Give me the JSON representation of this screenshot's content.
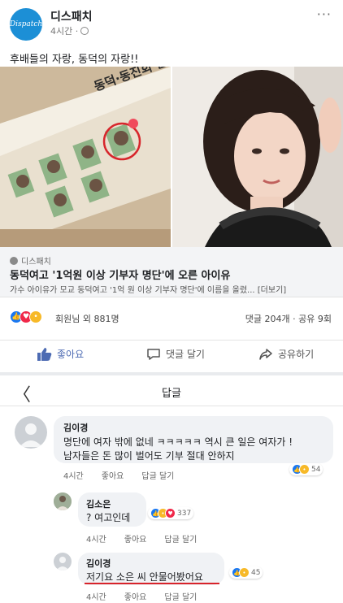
{
  "post": {
    "page_name": "디스패치",
    "avatar_text": "Dispatch",
    "time": "4시간 ·",
    "more": "···",
    "text": "후배들의 자랑, 동덕의 자랑!!"
  },
  "link": {
    "source": "디스패치",
    "title": "동덕여고 '1억원 이상 기부자 명단'에 오른 아이유",
    "description": "가수 아이유가 모교 동덕여고 '1억 원 이상 기부자 명단'에 이름을 올렸... [더보기]",
    "banner_text": "동덕·동진회 발전기금"
  },
  "reactions": {
    "summary": "회원님 외 881명",
    "engagement": "댓글 204개 · 공유 9회",
    "icons": [
      "like-icon",
      "love-icon",
      "wow-icon"
    ]
  },
  "actions": {
    "like": "좋아요",
    "comment": "댓글 달기",
    "share": "공유하기"
  },
  "reply_view": {
    "back": "〈",
    "title": "답글"
  },
  "comments": [
    {
      "author": "김이경",
      "line1": "명단에 여자 밖에 없네 ㅋㅋㅋㅋㅋ 역시 큰 일은 여자가 !",
      "line2": "남자들은 돈 많이 벌어도 기부 절대 안하지",
      "time": "4시간",
      "like": "좋아요",
      "reply": "답글 달기",
      "reaction_count": "54"
    },
    {
      "author": "김소은",
      "line1": "? 여고인데",
      "time": "4시간",
      "like": "좋아요",
      "reply": "답글 달기",
      "reaction_count": "337"
    },
    {
      "author": "김이경",
      "line1": "저기요 소은 씨 안물어봤어요",
      "time": "4시간",
      "like": "좋아요",
      "reply": "답글 달기",
      "reaction_count": "45"
    }
  ],
  "colors": {
    "facebook_blue": "#1877f2",
    "like_blue": "#4d6bb3",
    "love_red": "#f02849",
    "wow_yellow": "#f7b928",
    "highlight_red": "#d8232a"
  }
}
